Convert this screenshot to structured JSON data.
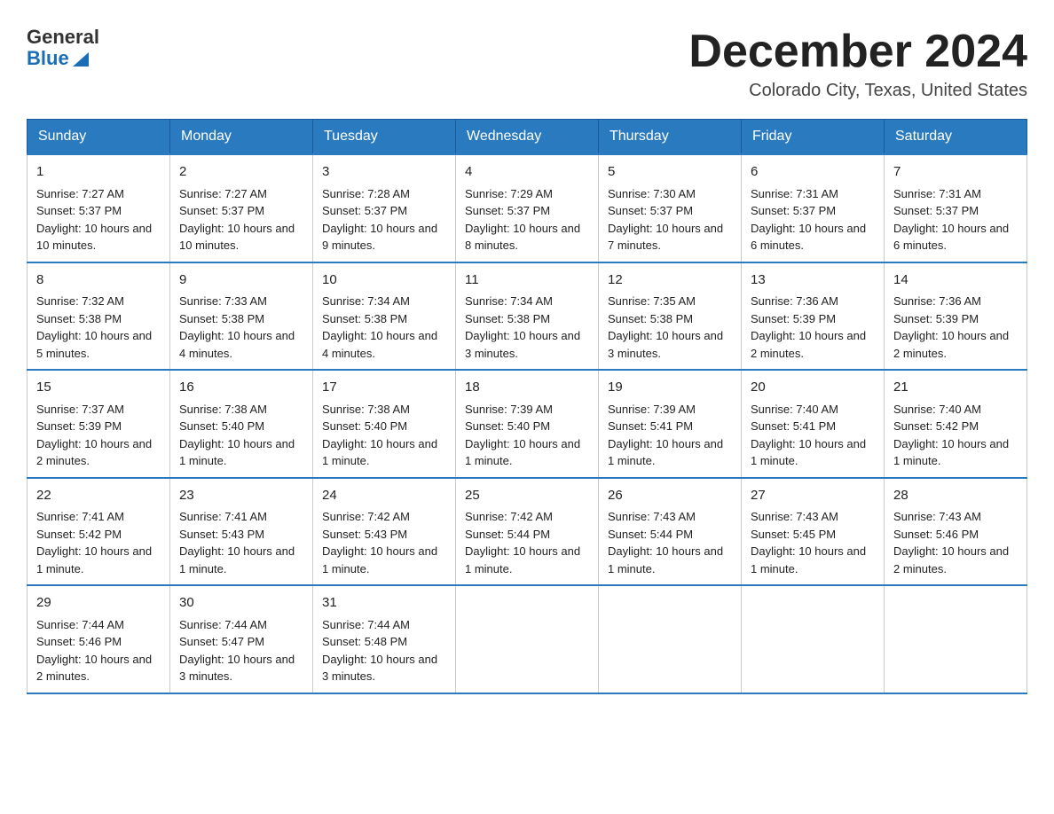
{
  "header": {
    "logo_general": "General",
    "logo_blue": "Blue",
    "month_year": "December 2024",
    "location": "Colorado City, Texas, United States"
  },
  "weekdays": [
    "Sunday",
    "Monday",
    "Tuesday",
    "Wednesday",
    "Thursday",
    "Friday",
    "Saturday"
  ],
  "weeks": [
    [
      {
        "day": "1",
        "sunrise": "7:27 AM",
        "sunset": "5:37 PM",
        "daylight": "10 hours and 10 minutes."
      },
      {
        "day": "2",
        "sunrise": "7:27 AM",
        "sunset": "5:37 PM",
        "daylight": "10 hours and 10 minutes."
      },
      {
        "day": "3",
        "sunrise": "7:28 AM",
        "sunset": "5:37 PM",
        "daylight": "10 hours and 9 minutes."
      },
      {
        "day": "4",
        "sunrise": "7:29 AM",
        "sunset": "5:37 PM",
        "daylight": "10 hours and 8 minutes."
      },
      {
        "day": "5",
        "sunrise": "7:30 AM",
        "sunset": "5:37 PM",
        "daylight": "10 hours and 7 minutes."
      },
      {
        "day": "6",
        "sunrise": "7:31 AM",
        "sunset": "5:37 PM",
        "daylight": "10 hours and 6 minutes."
      },
      {
        "day": "7",
        "sunrise": "7:31 AM",
        "sunset": "5:37 PM",
        "daylight": "10 hours and 6 minutes."
      }
    ],
    [
      {
        "day": "8",
        "sunrise": "7:32 AM",
        "sunset": "5:38 PM",
        "daylight": "10 hours and 5 minutes."
      },
      {
        "day": "9",
        "sunrise": "7:33 AM",
        "sunset": "5:38 PM",
        "daylight": "10 hours and 4 minutes."
      },
      {
        "day": "10",
        "sunrise": "7:34 AM",
        "sunset": "5:38 PM",
        "daylight": "10 hours and 4 minutes."
      },
      {
        "day": "11",
        "sunrise": "7:34 AM",
        "sunset": "5:38 PM",
        "daylight": "10 hours and 3 minutes."
      },
      {
        "day": "12",
        "sunrise": "7:35 AM",
        "sunset": "5:38 PM",
        "daylight": "10 hours and 3 minutes."
      },
      {
        "day": "13",
        "sunrise": "7:36 AM",
        "sunset": "5:39 PM",
        "daylight": "10 hours and 2 minutes."
      },
      {
        "day": "14",
        "sunrise": "7:36 AM",
        "sunset": "5:39 PM",
        "daylight": "10 hours and 2 minutes."
      }
    ],
    [
      {
        "day": "15",
        "sunrise": "7:37 AM",
        "sunset": "5:39 PM",
        "daylight": "10 hours and 2 minutes."
      },
      {
        "day": "16",
        "sunrise": "7:38 AM",
        "sunset": "5:40 PM",
        "daylight": "10 hours and 1 minute."
      },
      {
        "day": "17",
        "sunrise": "7:38 AM",
        "sunset": "5:40 PM",
        "daylight": "10 hours and 1 minute."
      },
      {
        "day": "18",
        "sunrise": "7:39 AM",
        "sunset": "5:40 PM",
        "daylight": "10 hours and 1 minute."
      },
      {
        "day": "19",
        "sunrise": "7:39 AM",
        "sunset": "5:41 PM",
        "daylight": "10 hours and 1 minute."
      },
      {
        "day": "20",
        "sunrise": "7:40 AM",
        "sunset": "5:41 PM",
        "daylight": "10 hours and 1 minute."
      },
      {
        "day": "21",
        "sunrise": "7:40 AM",
        "sunset": "5:42 PM",
        "daylight": "10 hours and 1 minute."
      }
    ],
    [
      {
        "day": "22",
        "sunrise": "7:41 AM",
        "sunset": "5:42 PM",
        "daylight": "10 hours and 1 minute."
      },
      {
        "day": "23",
        "sunrise": "7:41 AM",
        "sunset": "5:43 PM",
        "daylight": "10 hours and 1 minute."
      },
      {
        "day": "24",
        "sunrise": "7:42 AM",
        "sunset": "5:43 PM",
        "daylight": "10 hours and 1 minute."
      },
      {
        "day": "25",
        "sunrise": "7:42 AM",
        "sunset": "5:44 PM",
        "daylight": "10 hours and 1 minute."
      },
      {
        "day": "26",
        "sunrise": "7:43 AM",
        "sunset": "5:44 PM",
        "daylight": "10 hours and 1 minute."
      },
      {
        "day": "27",
        "sunrise": "7:43 AM",
        "sunset": "5:45 PM",
        "daylight": "10 hours and 1 minute."
      },
      {
        "day": "28",
        "sunrise": "7:43 AM",
        "sunset": "5:46 PM",
        "daylight": "10 hours and 2 minutes."
      }
    ],
    [
      {
        "day": "29",
        "sunrise": "7:44 AM",
        "sunset": "5:46 PM",
        "daylight": "10 hours and 2 minutes."
      },
      {
        "day": "30",
        "sunrise": "7:44 AM",
        "sunset": "5:47 PM",
        "daylight": "10 hours and 3 minutes."
      },
      {
        "day": "31",
        "sunrise": "7:44 AM",
        "sunset": "5:48 PM",
        "daylight": "10 hours and 3 minutes."
      },
      null,
      null,
      null,
      null
    ]
  ],
  "labels": {
    "sunrise": "Sunrise:",
    "sunset": "Sunset:",
    "daylight": "Daylight:"
  }
}
